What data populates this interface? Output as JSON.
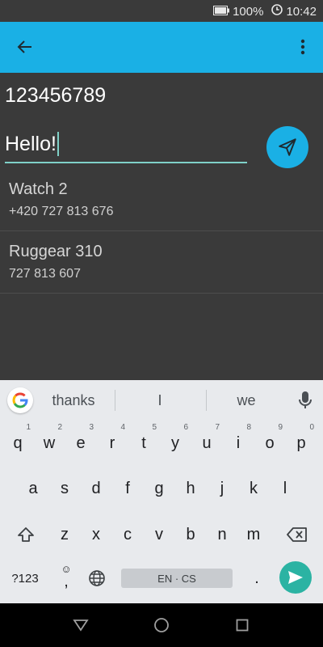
{
  "status": {
    "battery": "100%",
    "time": "10:42"
  },
  "appbar": {
    "back_icon": "arrow-back-icon",
    "menu_icon": "more-vert-icon",
    "color": "#1ab0e5"
  },
  "compose": {
    "number": "123456789",
    "message": "Hello!",
    "send_icon": "send-icon"
  },
  "contacts": [
    {
      "name": "Watch 2",
      "phone": "+420 727 813 676"
    },
    {
      "name": "Ruggear 310",
      "phone": "727 813 607"
    }
  ],
  "keyboard": {
    "suggestions": [
      "thanks",
      "I",
      "we"
    ],
    "row1": [
      {
        "k": "q",
        "h": "1"
      },
      {
        "k": "w",
        "h": "2"
      },
      {
        "k": "e",
        "h": "3"
      },
      {
        "k": "r",
        "h": "4"
      },
      {
        "k": "t",
        "h": "5"
      },
      {
        "k": "y",
        "h": "6"
      },
      {
        "k": "u",
        "h": "7"
      },
      {
        "k": "i",
        "h": "8"
      },
      {
        "k": "o",
        "h": "9"
      },
      {
        "k": "p",
        "h": "0"
      }
    ],
    "row2": [
      "a",
      "s",
      "d",
      "f",
      "g",
      "h",
      "j",
      "k",
      "l"
    ],
    "row3": [
      "z",
      "x",
      "c",
      "v",
      "b",
      "n",
      "m"
    ],
    "symbols_label": "?123",
    "comma_label": ",",
    "space_label": "EN · CS",
    "period_label": ".",
    "accent": "#2bb3a3"
  }
}
